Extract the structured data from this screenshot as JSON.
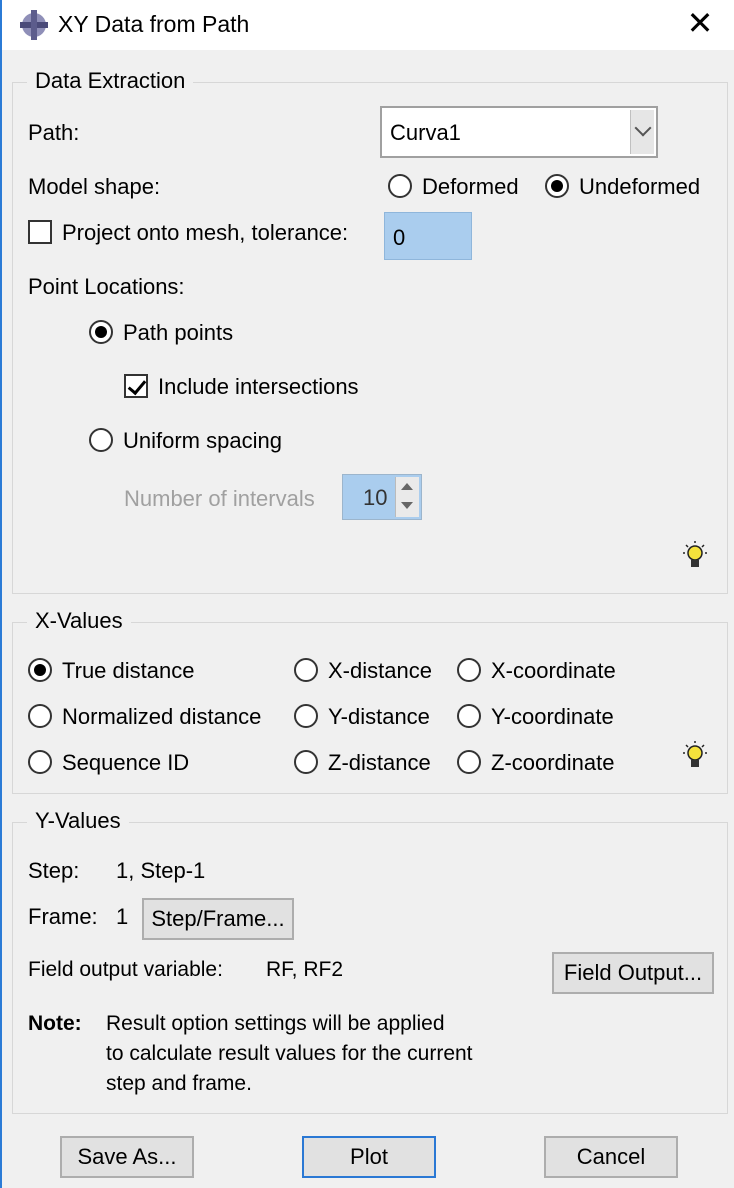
{
  "window": {
    "title": "XY Data from Path",
    "close_glyph": "✕"
  },
  "data_extraction": {
    "group_label": "Data Extraction",
    "path_label": "Path:",
    "path_value": "Curva1",
    "model_shape_label": "Model shape:",
    "deformed_label": "Deformed",
    "undeformed_label": "Undeformed",
    "model_shape_selected": "Undeformed",
    "project_label": "Project onto mesh, tolerance:",
    "project_checked": false,
    "tolerance_value": "0",
    "point_locations_label": "Point Locations:",
    "path_points_label": "Path points",
    "include_intersections_label": "Include intersections",
    "include_intersections_checked": true,
    "uniform_spacing_label": "Uniform spacing",
    "point_location_selected": "Path points",
    "intervals_label": "Number of intervals",
    "intervals_value": "10"
  },
  "x_values": {
    "group_label": "X-Values",
    "options": [
      "True distance",
      "X-distance",
      "X-coordinate",
      "Normalized distance",
      "Y-distance",
      "Y-coordinate",
      "Sequence ID",
      "Z-distance",
      "Z-coordinate"
    ],
    "selected": "True distance"
  },
  "y_values": {
    "group_label": "Y-Values",
    "step_label": "Step:",
    "step_value": "1, Step-1",
    "frame_label": "Frame:",
    "frame_value": "1",
    "step_frame_button": "Step/Frame...",
    "field_output_label": "Field output variable:",
    "field_output_value": "RF, RF2",
    "field_output_button": "Field Output...",
    "note_label": "Note:",
    "note_line1": "Result option settings will be applied",
    "note_line2": "to calculate result values for the current",
    "note_line3": "step and frame."
  },
  "buttons": {
    "save_as": "Save As...",
    "plot": "Plot",
    "cancel": "Cancel"
  },
  "colors": {
    "accent": "#2a78d4",
    "input_highlight": "#aacdee"
  }
}
